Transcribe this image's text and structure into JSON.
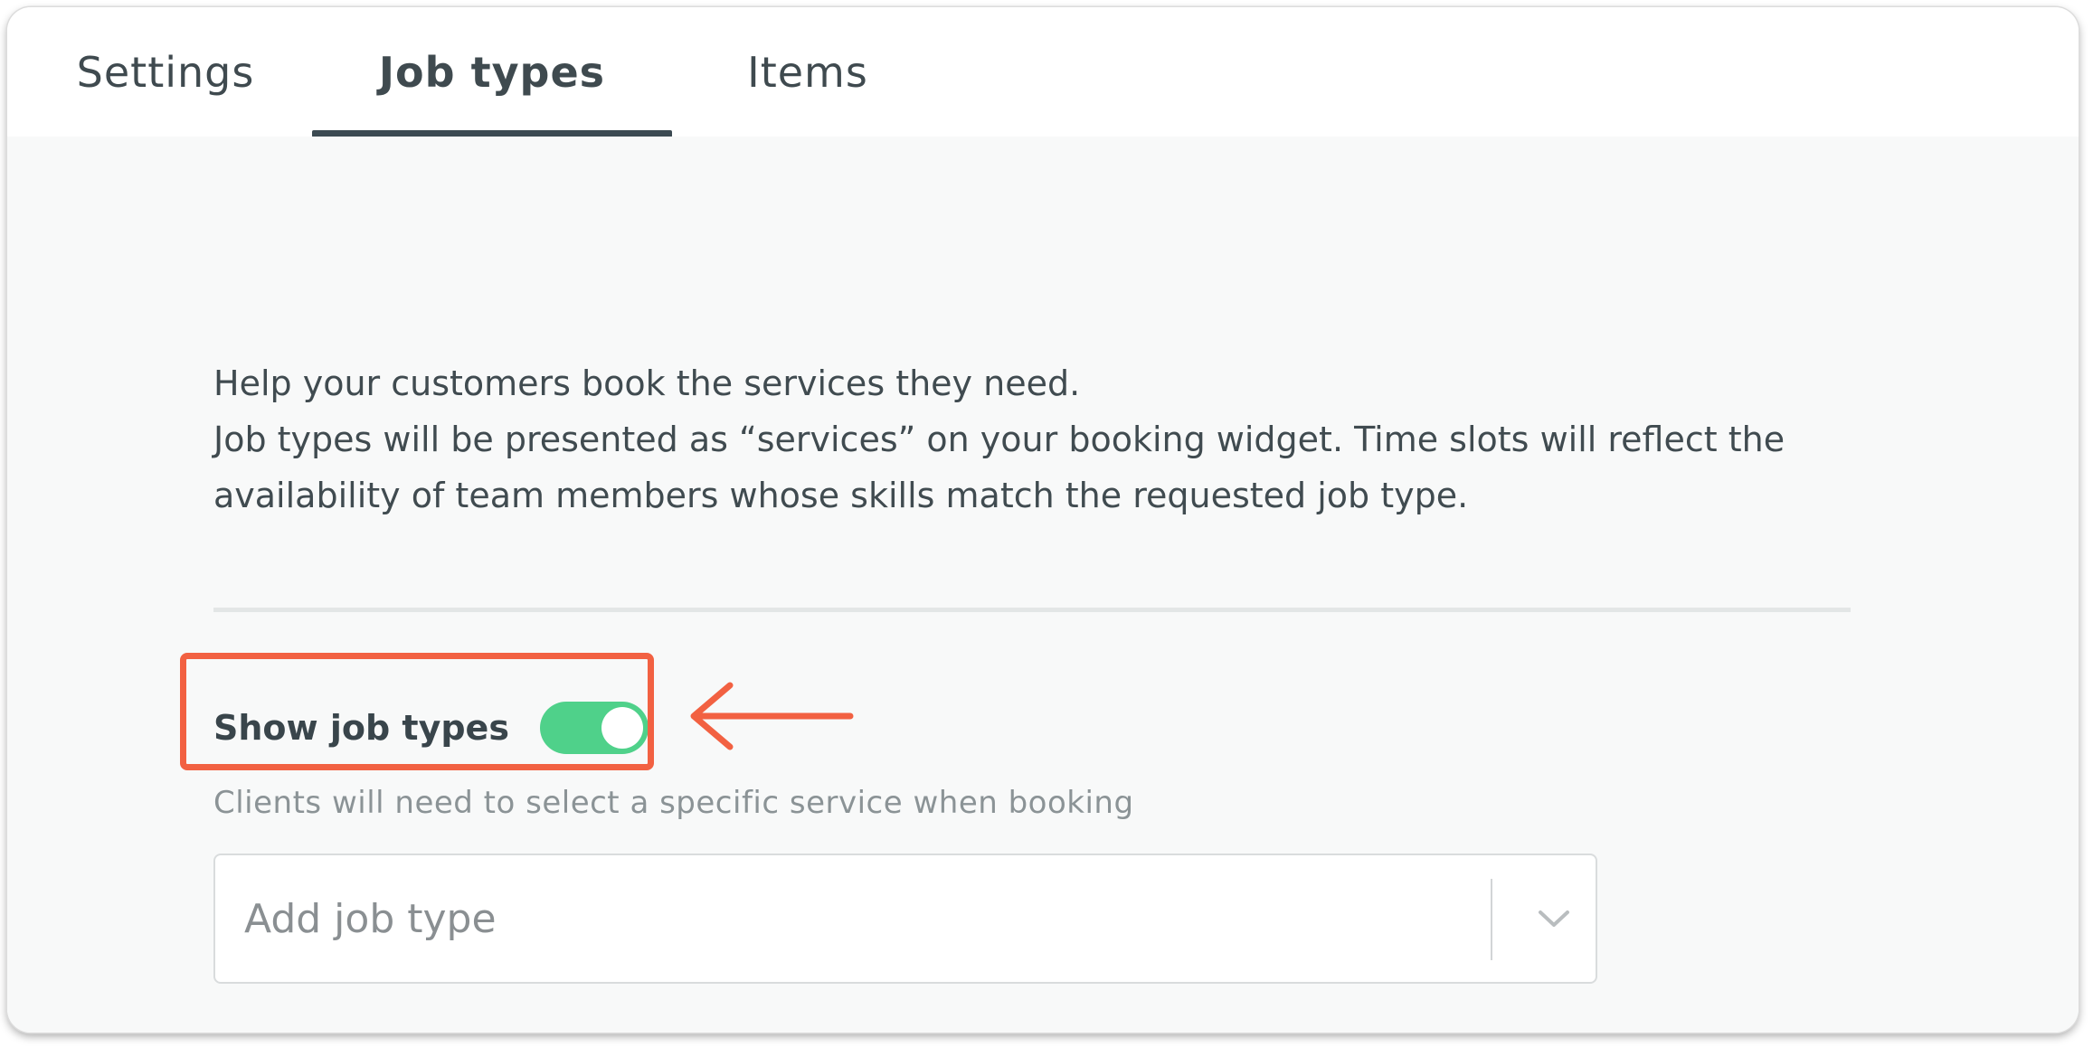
{
  "tabs": [
    {
      "label": "Settings",
      "active": false
    },
    {
      "label": "Job types",
      "active": true
    },
    {
      "label": "Items",
      "active": false
    }
  ],
  "description": {
    "line1": "Help your customers book the services they need.",
    "line2": "Job types will be presented as “services” on your booking widget. Time slots will reflect the",
    "line3": "availability of team members whose skills match the requested job type."
  },
  "toggle": {
    "label": "Show job types",
    "state": "on",
    "hint": "Clients will need to select a specific service when booking"
  },
  "job_type_select": {
    "placeholder": "Add job type"
  },
  "colors": {
    "toggle_on": "#4fd18a",
    "annotation": "#f26142",
    "tab_underline": "#3c4a52"
  },
  "icons": {
    "dropdown": "chevron-down-icon",
    "annotation": "arrow-left-icon"
  }
}
